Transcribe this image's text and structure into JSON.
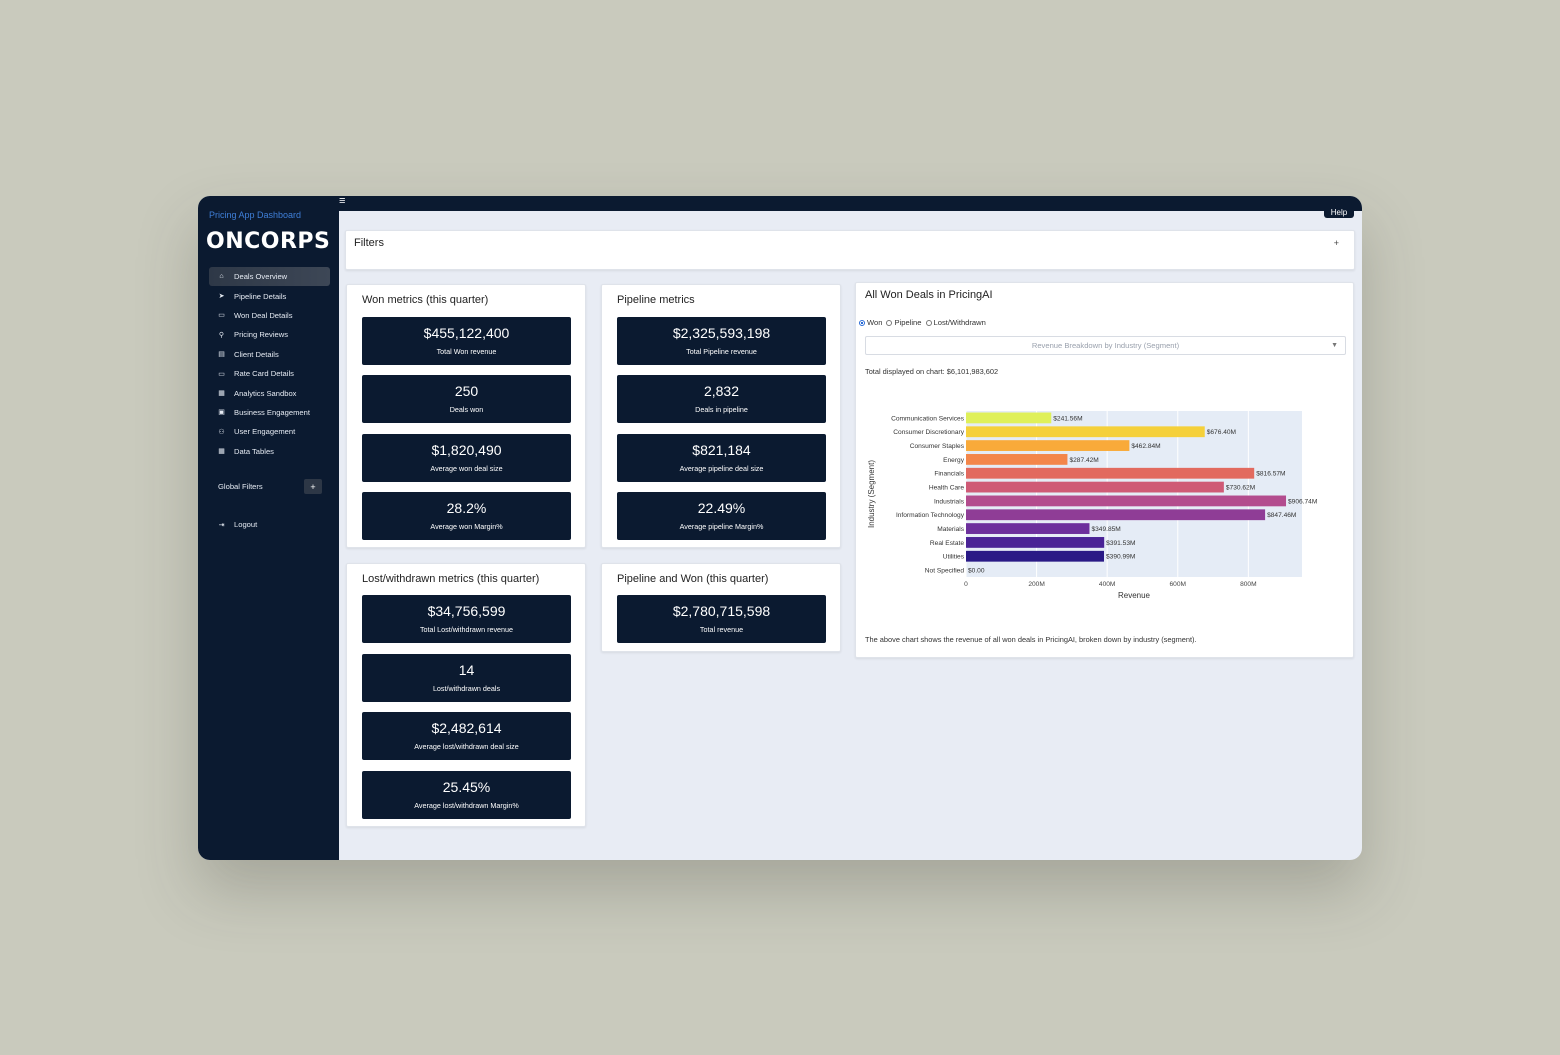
{
  "sidebar": {
    "app_subtitle": "Pricing App Dashboard",
    "logo": "ONCORPS",
    "items": [
      {
        "label": "Deals Overview",
        "icon": "home-icon",
        "glyph": "⌂",
        "active": true
      },
      {
        "label": "Pipeline Details",
        "icon": "send-icon",
        "glyph": "➤"
      },
      {
        "label": "Won Deal Details",
        "icon": "money-icon",
        "glyph": "▭"
      },
      {
        "label": "Pricing Reviews",
        "icon": "search-icon",
        "glyph": "⚲"
      },
      {
        "label": "Client Details",
        "icon": "file-icon",
        "glyph": "▤"
      },
      {
        "label": "Rate Card Details",
        "icon": "credit-card-icon",
        "glyph": "▭"
      },
      {
        "label": "Analytics Sandbox",
        "icon": "chart-icon",
        "glyph": "▦"
      },
      {
        "label": "Business Engagement",
        "icon": "briefcase-icon",
        "glyph": "▣"
      },
      {
        "label": "User Engagement",
        "icon": "users-icon",
        "glyph": "⚇"
      },
      {
        "label": "Data Tables",
        "icon": "table-icon",
        "glyph": "▦"
      }
    ],
    "global_filters_label": "Global Filters",
    "global_filters_button": "+",
    "logout_label": "Logout"
  },
  "topbar": {
    "help_label": "Help"
  },
  "filters": {
    "title": "Filters",
    "toggle": "+"
  },
  "won": {
    "title": "Won metrics (this quarter)",
    "metrics": [
      {
        "value": "$455,122,400",
        "label": "Total Won revenue"
      },
      {
        "value": "250",
        "label": "Deals won"
      },
      {
        "value": "$1,820,490",
        "label": "Average won deal size"
      },
      {
        "value": "28.2%",
        "label": "Average won Margin%"
      }
    ]
  },
  "pipeline": {
    "title": "Pipeline metrics",
    "metrics": [
      {
        "value": "$2,325,593,198",
        "label": "Total Pipeline revenue"
      },
      {
        "value": "2,832",
        "label": "Deals in pipeline"
      },
      {
        "value": "$821,184",
        "label": "Average pipeline deal size"
      },
      {
        "value": "22.49%",
        "label": "Average pipeline Margin%"
      }
    ]
  },
  "lost": {
    "title": "Lost/withdrawn metrics (this quarter)",
    "metrics": [
      {
        "value": "$34,756,599",
        "label": "Total Lost/withdrawn revenue"
      },
      {
        "value": "14",
        "label": "Lost/withdrawn deals"
      },
      {
        "value": "$2,482,614",
        "label": "Average lost/withdrawn deal size"
      },
      {
        "value": "25.45%",
        "label": "Average lost/withdrawn Margin%"
      }
    ]
  },
  "combined": {
    "title": "Pipeline and Won (this quarter)",
    "metrics": [
      {
        "value": "$2,780,715,598",
        "label": "Total revenue"
      }
    ]
  },
  "chart_panel": {
    "title": "All Won Deals in PricingAI",
    "radio_options": [
      {
        "label": "Won",
        "selected": true
      },
      {
        "label": "Pipeline",
        "selected": false
      },
      {
        "label": "Lost/Withdrawn",
        "selected": false
      }
    ],
    "dropdown_placeholder": "Revenue Breakdown by Industry (Segment)",
    "total_text": "Total displayed on chart: $6,101,983,602",
    "footnote": "The above chart shows the revenue of all won deals in PricingAI, broken down by industry (segment)."
  },
  "chart_data": {
    "type": "bar",
    "orientation": "horizontal",
    "categories": [
      "Communication Services",
      "Consumer Discretionary",
      "Consumer Staples",
      "Energy",
      "Financials",
      "Health Care",
      "Industrials",
      "Information Technology",
      "Materials",
      "Real Estate",
      "Utilities",
      "Not Specified"
    ],
    "values": [
      241.56,
      676.4,
      462.84,
      287.42,
      816.57,
      730.62,
      906.74,
      847.46,
      349.85,
      391.53,
      390.99,
      0
    ],
    "value_labels": [
      "$241.56M",
      "$676.40M",
      "$462.84M",
      "$287.42M",
      "$816.57M",
      "$730.62M",
      "$906.74M",
      "$847.46M",
      "$349.85M",
      "$391.53M",
      "$390.99M",
      "$0.00"
    ],
    "colors": [
      "#dff05a",
      "#f5d03a",
      "#f9aa3a",
      "#f3864a",
      "#e26a5f",
      "#cf5a76",
      "#b34c8e",
      "#8f3d96",
      "#6c2f9c",
      "#4a2396",
      "#2a1a86",
      "#131a68"
    ],
    "units": "M",
    "xlabel": "Revenue",
    "ylabel": "Industry (Segment)",
    "xticks": [
      0,
      200,
      400,
      600,
      800
    ],
    "xtick_labels": [
      "0",
      "200M",
      "400M",
      "600M",
      "800M"
    ],
    "xlim": [
      0,
      952
    ],
    "grid": true
  }
}
